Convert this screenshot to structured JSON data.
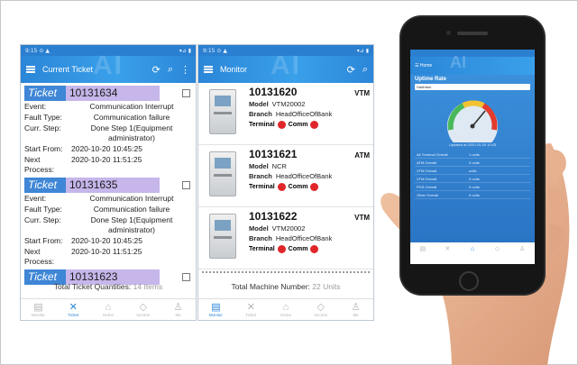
{
  "screens": {
    "tickets": {
      "status_left": "9:15 ⊙ ▲",
      "status_right": "▾⊿ ▮",
      "title": "Current Ticket",
      "tickets": [
        {
          "label": "Ticket",
          "number": "10131634",
          "rows": [
            {
              "k": "Event:",
              "v": "Communication Interrupt"
            },
            {
              "k": "Fault Type:",
              "v": "Communication failure"
            },
            {
              "k": "Curr. Step:",
              "v": "Done Step 1(Equipment administrator)"
            },
            {
              "k": "Start From:",
              "v": "2020-10-20 10:45:25"
            },
            {
              "k": "Next Process:",
              "v": "2020-10-20 11:51:25"
            }
          ]
        },
        {
          "label": "Ticket",
          "number": "10131635",
          "rows": [
            {
              "k": "Event:",
              "v": "Communication Interrupt"
            },
            {
              "k": "Fault Type:",
              "v": "Communication failure"
            },
            {
              "k": "Curr. Step:",
              "v": "Done Step 1(Equipment administrator)"
            },
            {
              "k": "Start From:",
              "v": "2020-10-20 10:45:25"
            },
            {
              "k": "Next Process:",
              "v": "2020-10-20 11:51:25"
            }
          ]
        },
        {
          "label": "Ticket",
          "number": "10131623",
          "rows": []
        }
      ],
      "total_label": "Total Ticket Quantities:",
      "total_value": "14 Items",
      "nav": [
        {
          "label": "Monitor",
          "icon": "▤"
        },
        {
          "label": "Ticket",
          "icon": "✕"
        },
        {
          "label": "Home",
          "icon": "⌂"
        },
        {
          "label": "Income",
          "icon": "◇"
        },
        {
          "label": "Me",
          "icon": "♙"
        }
      ]
    },
    "monitor": {
      "status_left": "9:15 ⊙ ▲",
      "status_right": "▾⊿ ▮",
      "title": "Monitor",
      "machines": [
        {
          "id": "10131620",
          "type": "VTM",
          "model_label": "Model",
          "model": "VTM20002",
          "branch_label": "Branch",
          "branch": "HeadOfficeOfBank",
          "terminal_label": "Terminal",
          "comm_label": "Comm"
        },
        {
          "id": "10131621",
          "type": "ATM",
          "model_label": "Model",
          "model": "NCR",
          "branch_label": "Branch",
          "branch": "HeadOfficeOfBank",
          "terminal_label": "Terminal",
          "comm_label": "Comm"
        },
        {
          "id": "10131622",
          "type": "VTM",
          "model_label": "Model",
          "model": "VTM20002",
          "branch_label": "Branch",
          "branch": "HeadOfficeOfBank",
          "terminal_label": "Terminal",
          "comm_label": "Comm"
        }
      ],
      "total_label": "Total Machine Number:",
      "total_value": "22 Units",
      "nav": [
        {
          "label": "Monitor",
          "icon": "▤"
        },
        {
          "label": "Ticket",
          "icon": "✕"
        },
        {
          "label": "Home",
          "icon": "⌂"
        },
        {
          "label": "Income",
          "icon": "◇"
        },
        {
          "label": "Me",
          "icon": "♙"
        }
      ]
    }
  },
  "phone": {
    "header": "Home",
    "section": "Uptime Rate",
    "select": "Hadbfant",
    "gauge_value": 0.72,
    "updated": "Updated at 2020-10-20 10:43",
    "rows": [
      {
        "a": "All Terminal Overall",
        "b": "1 units"
      },
      {
        "a": "ATM Overall",
        "b": "0 units"
      },
      {
        "a": "VTM Overall",
        "b": "units"
      },
      {
        "a": "VTM Overall",
        "b": "0 units"
      },
      {
        "a": "POS Overall",
        "b": "0 units"
      },
      {
        "a": "Other Overall",
        "b": "0 units"
      }
    ]
  },
  "colors": {
    "accent": "#2b86d8",
    "ticket_label": "#3f86d6",
    "ticket_number_bg": "#c6b6ea",
    "status_red": "#e0262a"
  }
}
